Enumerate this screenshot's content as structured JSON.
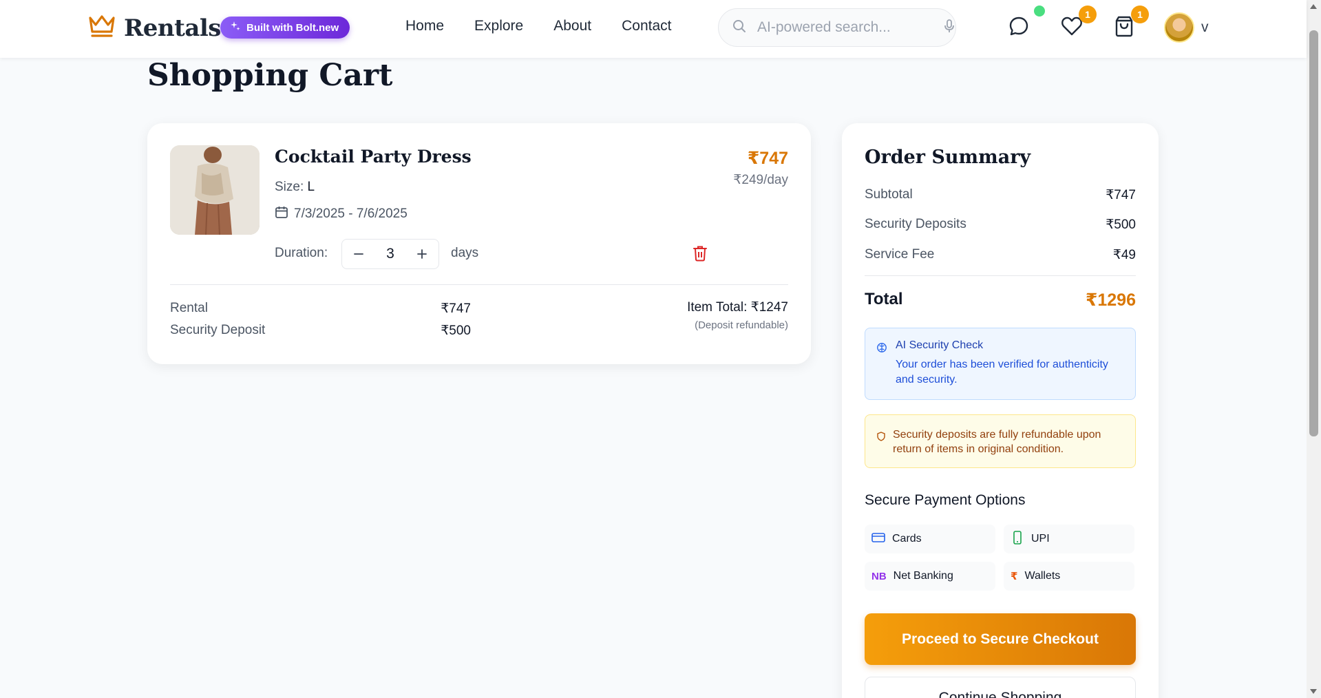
{
  "header": {
    "brand": "Rentals",
    "bolt_badge": "Built with Bolt.new",
    "nav": [
      "Home",
      "Explore",
      "About",
      "Contact"
    ],
    "search_placeholder": "AI-powered search...",
    "wishlist_count": "1",
    "cart_count": "1",
    "user_initial": "v"
  },
  "page": {
    "title": "Shopping Cart"
  },
  "cart_item": {
    "name": "Cocktail Party Dress",
    "size_label": "Size:",
    "size_value": "L",
    "dates": "7/3/2025 - 7/6/2025",
    "price": "₹747",
    "per_day": "₹249/day",
    "duration_label": "Duration:",
    "duration_value": "3",
    "duration_unit": "days",
    "rental_label": "Rental",
    "rental_value": "₹747",
    "deposit_label": "Security Deposit",
    "deposit_value": "₹500",
    "item_total": "Item Total: ₹1247",
    "deposit_note": "(Deposit refundable)"
  },
  "summary": {
    "title": "Order Summary",
    "rows": [
      {
        "label": "Subtotal",
        "value": "₹747"
      },
      {
        "label": "Security Deposits",
        "value": "₹500"
      },
      {
        "label": "Service Fee",
        "value": "₹49"
      }
    ],
    "total_label": "Total",
    "total_value": "₹1296",
    "ai_title": "AI Security Check",
    "ai_text": "Your order has been verified for authenticity and security.",
    "deposit_notice": "Security deposits are fully refundable upon return of items in original condition.",
    "payment_title": "Secure Payment Options",
    "payment_options": [
      {
        "label": "Cards",
        "icon": "credit-card-icon"
      },
      {
        "label": "UPI",
        "icon": "smartphone-icon"
      },
      {
        "label": "Net Banking",
        "icon": "nb-icon",
        "icon_text": "NB"
      },
      {
        "label": "Wallets",
        "icon": "rupee-icon",
        "icon_text": "₹"
      }
    ],
    "checkout_label": "Proceed to Secure Checkout",
    "continue_label": "Continue Shopping"
  },
  "colors": {
    "accent": "#d97706",
    "bolt_purple": "#7c3aed",
    "danger": "#dc2626"
  }
}
